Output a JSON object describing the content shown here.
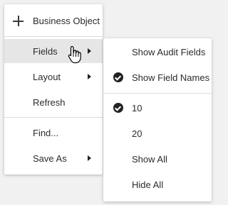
{
  "main_menu": {
    "items": [
      {
        "label": "Business Object",
        "icon": "plus-icon"
      },
      {
        "label": "Fields",
        "has_submenu": true,
        "highlighted": true
      },
      {
        "label": "Layout",
        "has_submenu": true
      },
      {
        "label": "Refresh"
      },
      {
        "label": "Find..."
      },
      {
        "label": "Save As",
        "has_submenu": true
      }
    ]
  },
  "sub_menu": {
    "items": [
      {
        "label": "Show Audit Fields",
        "checked": false
      },
      {
        "label": "Show Field Names",
        "checked": true
      },
      {
        "label": "10",
        "checked": true
      },
      {
        "label": "20",
        "checked": false
      },
      {
        "label": "Show All",
        "checked": false
      },
      {
        "label": "Hide All",
        "checked": false
      }
    ]
  },
  "colors": {
    "highlight": "#e6e6e6",
    "menu_background": "#ffffff",
    "text": "#2b2b2b"
  }
}
